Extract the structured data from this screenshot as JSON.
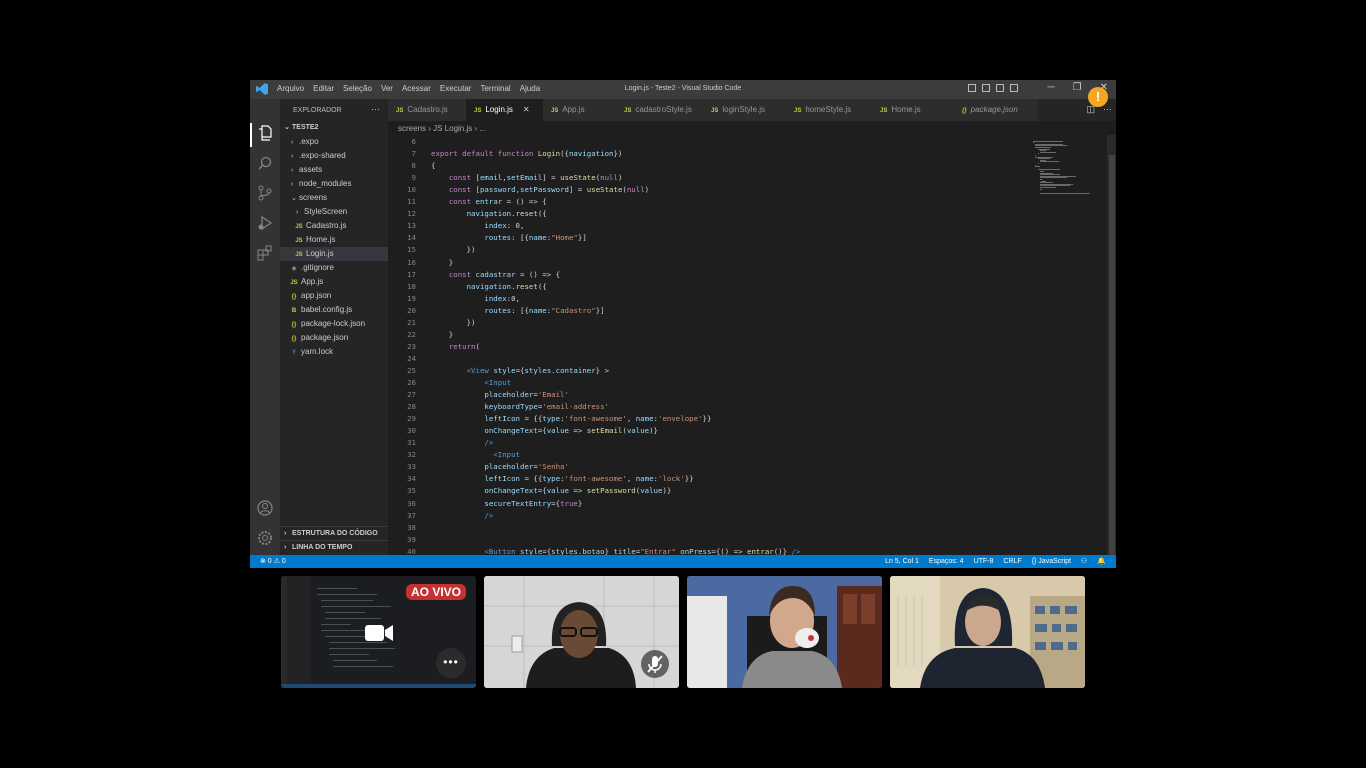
{
  "window": {
    "title": "Login.js - Teste2 - Visual Studio Code",
    "menu": [
      "Arquivo",
      "Editar",
      "Seleção",
      "Ver",
      "Acessar",
      "Executar",
      "Terminal",
      "Ajuda"
    ],
    "controls": [
      "─",
      "❐",
      "✕"
    ]
  },
  "sidebar": {
    "header": "EXPLORADOR",
    "more": "···",
    "project": "TESTE2",
    "items": [
      {
        "label": ".expo",
        "chevron": "›"
      },
      {
        "label": ".expo-shared",
        "chevron": "›"
      },
      {
        "label": "assets",
        "chevron": "›"
      },
      {
        "label": "node_modules",
        "chevron": "›"
      },
      {
        "label": "screens",
        "chevron": "⌄"
      },
      {
        "label": "StyleScreen",
        "chevron": "›"
      },
      {
        "label": "Cadastro.js",
        "icon": "JS"
      },
      {
        "label": "Home.js",
        "icon": "JS"
      },
      {
        "label": "Login.js",
        "icon": "JS"
      },
      {
        "label": ".gitignore",
        "icon": "◆"
      },
      {
        "label": "App.js",
        "icon": "JS"
      },
      {
        "label": "app.json",
        "icon": "{}"
      },
      {
        "label": "babel.config.js",
        "icon": "B"
      },
      {
        "label": "package-lock.json",
        "icon": "{}"
      },
      {
        "label": "package.json",
        "icon": "{}"
      },
      {
        "label": "yarn.lock",
        "icon": "Y"
      }
    ],
    "outline": "ESTRUTURA DO CÓDIGO",
    "timeline": "LINHA DO TEMPO"
  },
  "tabs": [
    {
      "label": "Cadastro.js",
      "icon": "JS"
    },
    {
      "label": "Login.js",
      "icon": "JS",
      "close": "✕"
    },
    {
      "label": "App.js",
      "icon": "JS"
    },
    {
      "label": "cadastroStyle.js",
      "icon": "JS"
    },
    {
      "label": "loginStyle.js",
      "icon": "JS"
    },
    {
      "label": "homeStyle.js",
      "icon": "JS"
    },
    {
      "label": "Home.js",
      "icon": "JS"
    },
    {
      "label": "package.json",
      "icon": "{}"
    }
  ],
  "tab_tools": [
    "◫",
    "···"
  ],
  "breadcrumb": "screens  ›  JS Login.js  ›  ...",
  "code_lines": [
    {
      "n": "6",
      "t": ""
    },
    {
      "n": "7",
      "t": "export default function Login({navigation})"
    },
    {
      "n": "8",
      "t": "{"
    },
    {
      "n": "9",
      "t": "    const [email,setEmail] = useState(null)"
    },
    {
      "n": "10",
      "t": "    const [password,setPassword] = useState(null)"
    },
    {
      "n": "11",
      "t": "    const entrar = () => {"
    },
    {
      "n": "12",
      "t": "        navigation.reset({"
    },
    {
      "n": "13",
      "t": "            index: 0,"
    },
    {
      "n": "14",
      "t": "            routes: [{name:\"Home\"}]"
    },
    {
      "n": "15",
      "t": "        })"
    },
    {
      "n": "16",
      "t": "    }"
    },
    {
      "n": "17",
      "t": "    const cadastrar = () => {"
    },
    {
      "n": "18",
      "t": "        navigation.reset({"
    },
    {
      "n": "19",
      "t": "            index:0,"
    },
    {
      "n": "20",
      "t": "            routes: [{name:\"Cadastro\"}]"
    },
    {
      "n": "21",
      "t": "        })"
    },
    {
      "n": "22",
      "t": "    }"
    },
    {
      "n": "23",
      "t": "    return("
    },
    {
      "n": "24",
      "t": ""
    },
    {
      "n": "25",
      "t": "        <View style={styles.container} >"
    },
    {
      "n": "26",
      "t": "            <Input"
    },
    {
      "n": "27",
      "t": "            placeholder='Email'"
    },
    {
      "n": "28",
      "t": "            keyboardType='email-address'"
    },
    {
      "n": "29",
      "t": "            leftIcon = {{type:'font-awesome', name:'envelope'}}"
    },
    {
      "n": "30",
      "t": "            onChangeText={value => setEmail(value)}"
    },
    {
      "n": "31",
      "t": "            />"
    },
    {
      "n": "32",
      "t": "              <Input"
    },
    {
      "n": "33",
      "t": "            placeholder='Senha'"
    },
    {
      "n": "34",
      "t": "            leftIcon = {{type:'font-awesome', name:'lock'}}"
    },
    {
      "n": "35",
      "t": "            onChangeText={value => setPassword(value)}"
    },
    {
      "n": "36",
      "t": "            secureTextEntry={true}"
    },
    {
      "n": "37",
      "t": "            />"
    },
    {
      "n": "38",
      "t": ""
    },
    {
      "n": "39",
      "t": ""
    },
    {
      "n": "40",
      "t": "            <Button style={styles.botao} title=\"Entrar\" onPress={() => entrar()} />"
    }
  ],
  "status": {
    "left": "⊗ 0 ⚠ 0",
    "items": [
      "Ln 5, Col 1",
      "Espaços: 4",
      "UTF-8",
      "CRLF",
      "{} JavaScript",
      "⚇",
      "🔔"
    ]
  },
  "notification": "!",
  "meeting": {
    "live_label": "AO VIVO",
    "more": "•••"
  },
  "colors": {
    "accent": "#007acc",
    "keyword": "#c586c0",
    "string": "#ce9178",
    "function": "#dcdcaa",
    "variable": "#9cdcfe",
    "live": "#c53030"
  }
}
